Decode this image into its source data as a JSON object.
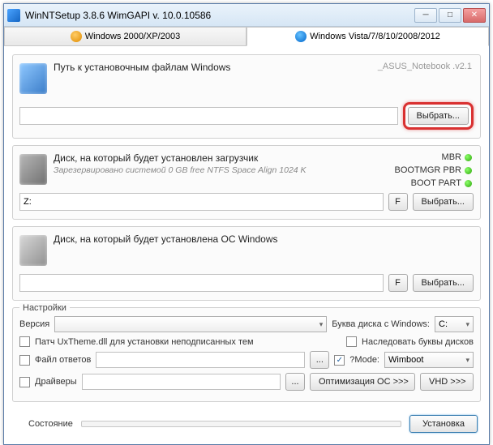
{
  "window": {
    "title": "WinNTSetup 3.8.6       WimGAPI v. 10.0.10586"
  },
  "tabs": {
    "xp": "Windows 2000/XP/2003",
    "vista": "Windows Vista/7/8/10/2008/2012"
  },
  "section1": {
    "title": "Путь к установочным файлам Windows",
    "config": "_ASUS_Notebook .v2.1",
    "select_btn": "Выбрать..."
  },
  "section2": {
    "title": "Диск, на который будет установлен загрузчик",
    "sub": "Зарезервировано системой 0 GB free NTFS Space Align 1024 K",
    "drive": "Z:",
    "f_btn": "F",
    "select_btn": "Выбрать...",
    "status": {
      "mbr": "MBR",
      "bootmgr": "BOOTMGR PBR",
      "bootpart": "BOOT PART"
    }
  },
  "section3": {
    "title": "Диск, на который будет установлена ОС Windows",
    "f_btn": "F",
    "select_btn": "Выбрать..."
  },
  "settings": {
    "group": "Настройки",
    "version_label": "Версия",
    "drive_letter_label": "Буква диска с Windows:",
    "drive_letter_value": "C:",
    "uxtheme": "Патч UxTheme.dll для установки неподписанных тем",
    "inherit_letters": "Наследовать буквы дисков",
    "answer_file": "Файл ответов",
    "mode_label": "?Mode:",
    "mode_value": "Wimboot",
    "drivers": "Драйверы",
    "optimize": "Оптимизация ОС >>>",
    "vhd": "VHD >>>",
    "browse": "..."
  },
  "footer": {
    "state": "Состояние",
    "install": "Установка"
  }
}
